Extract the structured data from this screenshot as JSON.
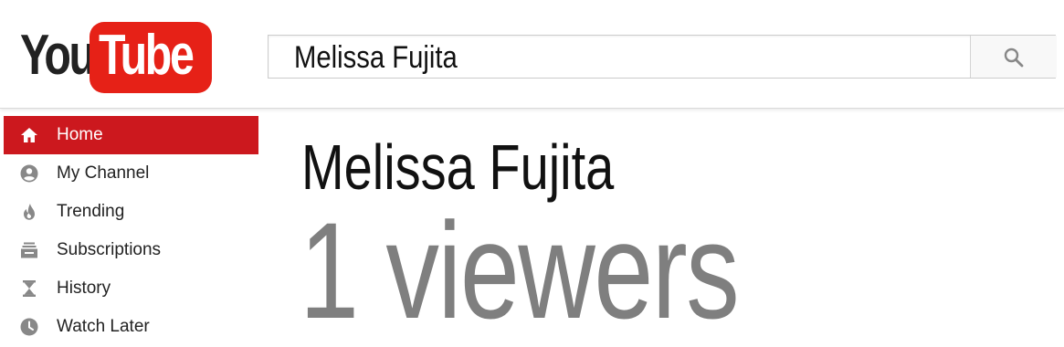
{
  "brand": {
    "logo_left": "You",
    "logo_right": "Tube",
    "accent": "#e62117"
  },
  "search": {
    "value": "Melissa Fujita",
    "icon": "search-icon"
  },
  "sidebar": {
    "items": [
      {
        "label": "Home",
        "icon": "home-icon",
        "active": true
      },
      {
        "label": "My Channel",
        "icon": "account-icon",
        "active": false
      },
      {
        "label": "Trending",
        "icon": "flame-icon",
        "active": false
      },
      {
        "label": "Subscriptions",
        "icon": "subscriptions-icon",
        "active": false
      },
      {
        "label": "History",
        "icon": "hourglass-icon",
        "active": false
      },
      {
        "label": "Watch Later",
        "icon": "clock-icon",
        "active": false
      }
    ],
    "active_color": "#cc181e"
  },
  "main": {
    "channel_name": "Melissa Fujita",
    "viewers": "1 viewers"
  }
}
